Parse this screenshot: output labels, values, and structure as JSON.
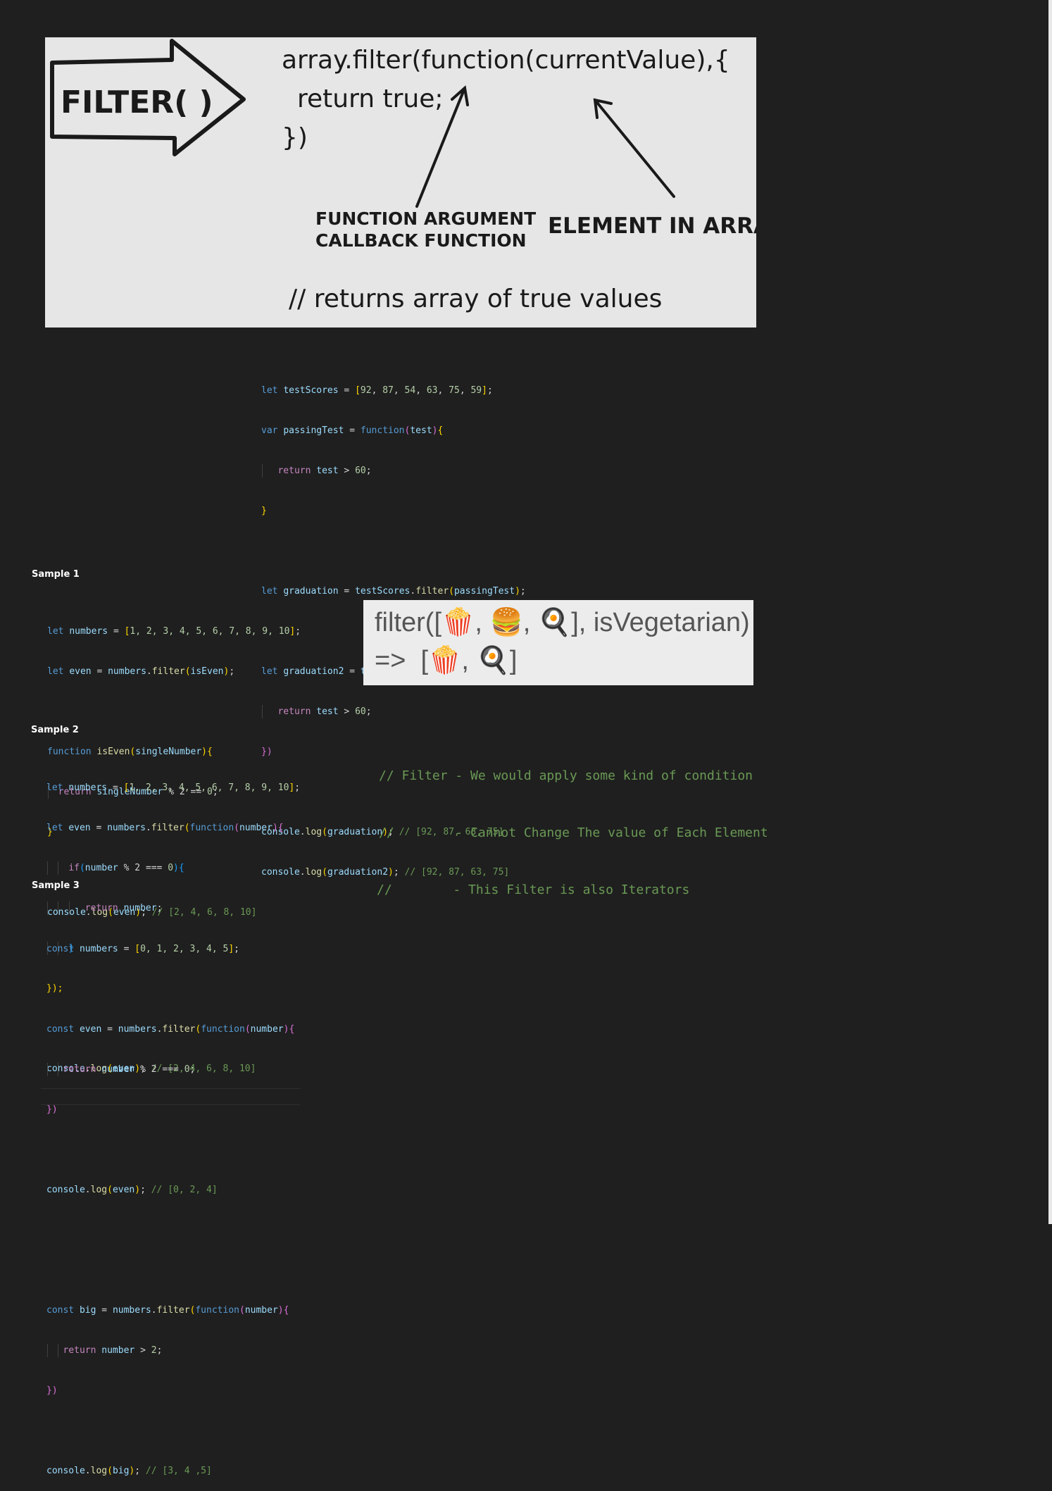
{
  "diagram": {
    "filter_label": "FILTER( )",
    "code_line1": "array.filter(function(currentValue),{",
    "code_line2": "return true;",
    "code_line3": "})",
    "callout_left_line1": "FUNCTION ARGUMENT",
    "callout_left_line2": "CALLBACK FUNCTION",
    "callout_right": "ELEMENT IN ARRAY",
    "footer": "// returns array of true values"
  },
  "code_main": {
    "l1": [
      "let",
      "testScores",
      "=",
      "[",
      "92",
      ", ",
      "87",
      ", ",
      "54",
      ", ",
      "63",
      ", ",
      "75",
      ", ",
      "59",
      "]",
      ";"
    ],
    "l2": [
      "var",
      "passingTest",
      "=",
      "function",
      "(",
      "test",
      ")",
      "{"
    ],
    "l3": [
      "return",
      "test",
      ">",
      "60",
      ";"
    ],
    "l4": [
      "}"
    ],
    "l6": [
      "let",
      "graduation",
      "=",
      "testScores",
      ".",
      "filter",
      "(",
      "passingTest",
      ")",
      ";"
    ],
    "l8": [
      "let",
      "graduation2",
      "=",
      "testScores",
      ".",
      "filter",
      "(",
      "function",
      "(",
      "test",
      ")",
      "{"
    ],
    "l9": [
      "return",
      "test",
      ">",
      "60",
      ";"
    ],
    "l10": [
      "})"
    ],
    "l12": [
      "console",
      ".",
      "log",
      "(",
      "graduation",
      ")",
      ";",
      "// [92, 87, 63, 75]"
    ],
    "l13": [
      "console",
      ".",
      "log",
      "(",
      "graduation2",
      ")",
      ";",
      "// [92, 87, 63, 75]"
    ]
  },
  "sample1": {
    "title": "Sample 1",
    "l1": [
      "let",
      "numbers",
      "=",
      "[",
      "1, 2, 3, 4, 5, 6, 7, 8, 9, 10",
      "]",
      ";"
    ],
    "l2": [
      "let",
      "even",
      "=",
      "numbers",
      ".",
      "filter",
      "(",
      "isEven",
      ")",
      ";"
    ],
    "l4": [
      "function",
      "isEven",
      "(",
      "singleNumber",
      ")",
      "{"
    ],
    "l5": [
      "return",
      "singleNumber",
      "% 2 ==",
      "0",
      ";"
    ],
    "l6": [
      "}"
    ],
    "l8": [
      "console",
      ".",
      "log",
      "(",
      "even",
      ")",
      ";",
      "// [2, 4, 6, 8, 10]"
    ]
  },
  "sample2": {
    "title": "Sample 2",
    "l1": [
      "let",
      "numbers",
      "=",
      "[",
      "1, 2, 3, 4, 5, 6, 7, 8, 9, 10",
      "]",
      ";"
    ],
    "l2": [
      "let",
      "even",
      "=",
      "numbers",
      ".",
      "filter",
      "(",
      "function",
      "(",
      "number",
      ")",
      "{"
    ],
    "l3": [
      "if",
      "(",
      "number",
      "% 2 ===",
      "0",
      ")",
      "{"
    ],
    "l4": [
      "return",
      "number",
      ";"
    ],
    "l5": [
      "}"
    ],
    "l6": [
      "});"
    ],
    "l8": [
      "console",
      ".",
      "log",
      "(",
      "even",
      ")",
      ";",
      "// [2, 4, 6, 8, 10]"
    ]
  },
  "sample3": {
    "title": "Sample 3",
    "l1": [
      "const",
      "numbers",
      "=",
      "[",
      "0, 1, 2, 3, 4, 5",
      "]",
      ";"
    ],
    "l3": [
      "const",
      "even",
      "=",
      "numbers",
      ".",
      "filter",
      "(",
      "function",
      "(",
      "number",
      ")",
      "{"
    ],
    "l4": [
      "return",
      "number",
      "% 2 ===",
      "0",
      ";"
    ],
    "l5": [
      "})"
    ],
    "l7": [
      "console",
      ".",
      "log",
      "(",
      "even",
      ")",
      ";",
      "// [0, 2, 4]"
    ],
    "l10": [
      "const",
      "big",
      "=",
      "numbers",
      ".",
      "filter",
      "(",
      "function",
      "(",
      "number",
      ")",
      "{"
    ],
    "l11": [
      "return",
      "number",
      ">",
      "2",
      ";"
    ],
    "l12": [
      "})"
    ],
    "l14": [
      "console",
      ".",
      "log",
      "(",
      "big",
      ")",
      ";",
      "// [3, 4 ,5]"
    ]
  },
  "emoji_panel": {
    "line1_prefix": "filter([",
    "line1_suffix": "], isVegetarian)",
    "line2_prefix": "=>  [",
    "line2_suffix": "]",
    "sep": ",",
    "emoji_popcorn": "🍿",
    "emoji_burger": "🍔",
    "emoji_egg": "🍳"
  },
  "notes": {
    "n1": "// Filter - We would apply some kind of condition",
    "n2": "//        - Cannot Change The value of Each Element",
    "n3": "//        - This Filter is also Iterators"
  }
}
